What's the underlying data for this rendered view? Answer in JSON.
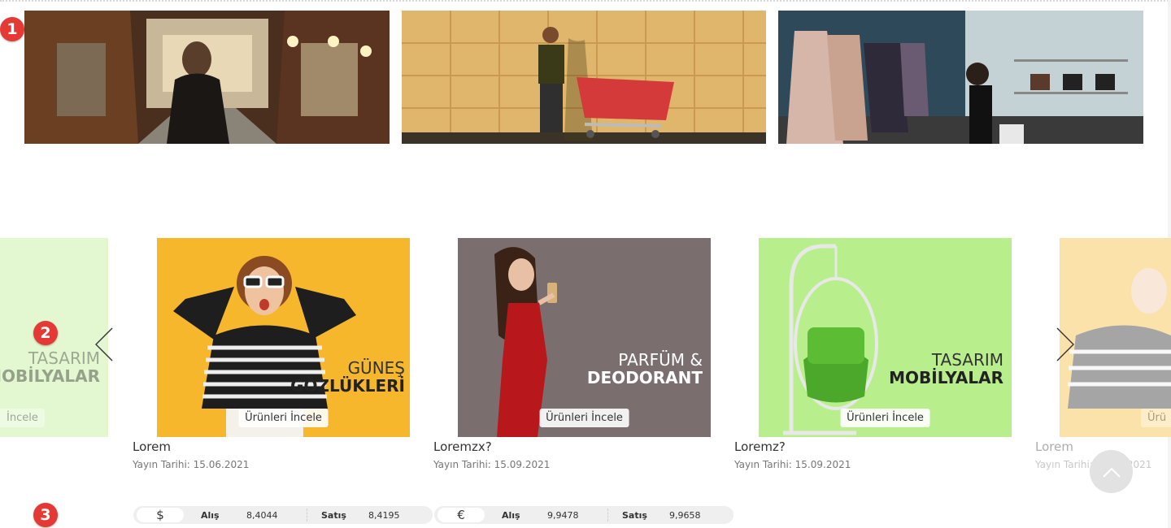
{
  "markers": [
    "1",
    "2",
    "3"
  ],
  "banners": [
    {
      "name": "arcade-street-banner",
      "alt": "shopping arcade"
    },
    {
      "name": "shopping-cart-banner",
      "alt": "man with shopping cart"
    },
    {
      "name": "clothing-store-banner",
      "alt": "woman shopping for clothes"
    }
  ],
  "carousel": {
    "button_label": "Ürünleri İncele",
    "partial_left": {
      "line1": "TASARIM",
      "line2": "MOBİLYALAR",
      "button": "İncele"
    },
    "slides": [
      {
        "line1": "GÜNEŞ",
        "line2": "GÖZLÜKLERİ",
        "title": "Lorem",
        "date": "Yayın Tarihi: 15.06.2021"
      },
      {
        "line1": "PARFÜM &",
        "line2": "DEODORANT",
        "title": "Loremzx?",
        "date": "Yayın Tarihi: 15.09.2021"
      },
      {
        "line1": "TASARIM",
        "line2": "MOBİLYALAR",
        "title": "Loremz?",
        "date": "Yayın Tarihi: 15.09.2021"
      }
    ],
    "partial_right": {
      "title": "Lorem",
      "date": "Yayın Tarihi: 15.06.2021",
      "button": "Ürü"
    }
  },
  "currency": [
    {
      "symbol": "$",
      "buy_label": "Alış",
      "buy": "8,4044",
      "sell_label": "Satış",
      "sell": "8,4195"
    },
    {
      "symbol": "€",
      "buy_label": "Alış",
      "buy": "9,9478",
      "sell_label": "Satış",
      "sell": "9,9658"
    }
  ],
  "colors": {
    "marker": "#e53935",
    "sunglasses_bg": "#f6b72c",
    "perfume_bg": "#7a6e6f",
    "furniture_bg": "#b9ee8c"
  }
}
